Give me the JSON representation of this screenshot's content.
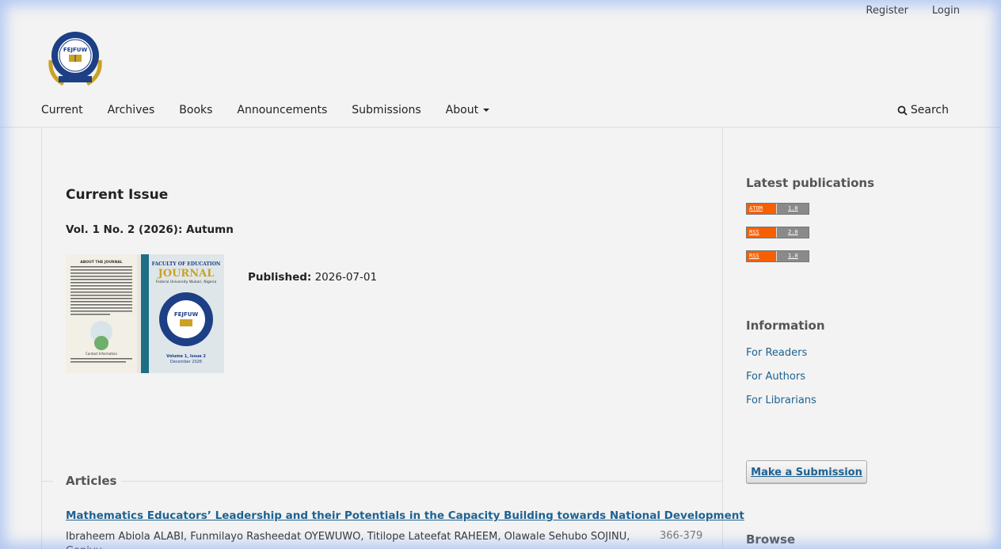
{
  "header": {
    "register": "Register",
    "login": "Login",
    "logo_text": "FEJFUW",
    "logo_ring_text": "FACULTY OF EDUCATION JOURNAL"
  },
  "nav": {
    "items": [
      "Current",
      "Archives",
      "Books",
      "Announcements",
      "Submissions",
      "About"
    ],
    "search": "Search"
  },
  "main": {
    "heading": "Current Issue",
    "issue_id": "Vol. 1 No. 2 (2026): Autumn",
    "published_label": "Published:",
    "published_value": "2026-07-01",
    "cover": {
      "title_top": "FACULTY OF EDUCATION",
      "title_main": "JOURNAL",
      "subtitle": "Federal University Wukari, Nigeria",
      "volume": "Volume 1, Issue 2",
      "date": "December 2026",
      "about_heading": "ABOUT THE JOURNAL",
      "contact": "Contact Information"
    },
    "articles_label": "Articles",
    "article": {
      "title": "Mathematics Educators’ Leadership and their Potentials in the Capacity Building towards National Development",
      "authors": "Ibraheem Abiola ALABI, Funmilayo Rasheedat OYEWUWO, Titilope Lateefat RAHEEM, Olawale Sehubo SOJINU, Ganiyu",
      "pages": "366-379"
    }
  },
  "sidebar": {
    "latest_title": "Latest publications",
    "feeds": [
      {
        "left": "ATOM",
        "right": "1.0"
      },
      {
        "left": "RSS",
        "right": "2.0"
      },
      {
        "left": "RSS",
        "right": "1.0"
      }
    ],
    "info_title": "Information",
    "info_links": [
      "For Readers",
      "For Authors",
      "For Librarians"
    ],
    "submit_label": "Make a Submission",
    "browse_title": "Browse"
  },
  "colors": {
    "link": "#1e6292",
    "background": "#f3f3f3",
    "feed_orange": "#f66002"
  }
}
